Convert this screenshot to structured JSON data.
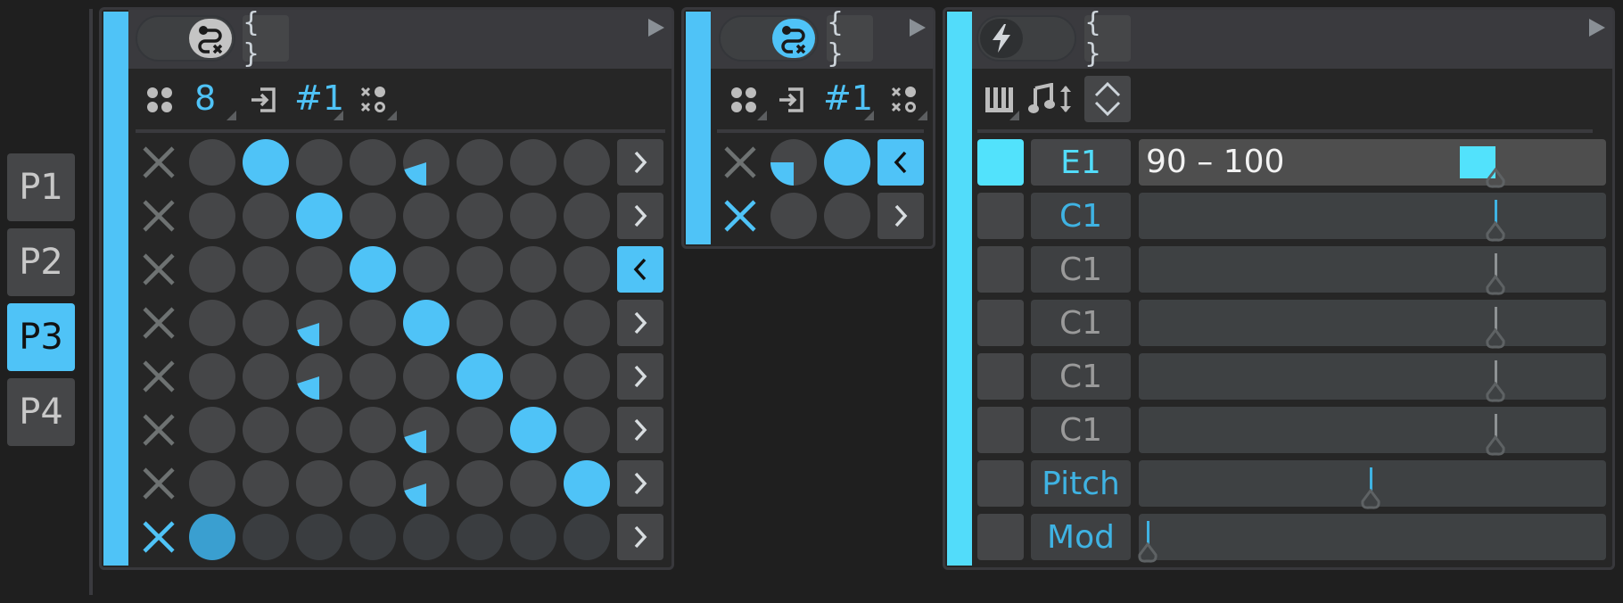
{
  "colors": {
    "accent": "#4fc3f7",
    "accent_cyan": "#52e2fc",
    "accent_dim": "#3a9fd0",
    "cell_off": "#454648",
    "cell_off_dim": "#3a3d40",
    "x_off": "#6e7272",
    "panel_bg": "#262626",
    "header_bg": "#3a3a3e"
  },
  "pages": {
    "items": [
      {
        "label": "P1",
        "active": false
      },
      {
        "label": "P2",
        "active": false
      },
      {
        "label": "P3",
        "active": true
      },
      {
        "label": "P4",
        "active": false
      }
    ]
  },
  "panel1": {
    "toggle_icon": "route-off-icon",
    "toggle_on": false,
    "braces_label": "{ }",
    "toolbar": {
      "steps_icon": "four-dots-icon",
      "steps_value": "8",
      "input_icon": "enter-icon",
      "channel_value": "#1",
      "mode_icon": "xo-pattern-icon"
    },
    "grid": {
      "columns": 8,
      "rows": [
        {
          "x_active": false,
          "cells": [
            0,
            1,
            0,
            0,
            0.2,
            0,
            0,
            0
          ],
          "button": ">",
          "button_active": false
        },
        {
          "x_active": false,
          "cells": [
            0,
            0,
            1,
            0,
            0,
            0,
            0,
            0
          ],
          "button": ">",
          "button_active": false
        },
        {
          "x_active": false,
          "cells": [
            0,
            0,
            0,
            1,
            0,
            0,
            0,
            0
          ],
          "button": "<",
          "button_active": true
        },
        {
          "x_active": false,
          "cells": [
            0,
            0,
            0.2,
            0,
            1,
            0,
            0,
            0
          ],
          "button": ">",
          "button_active": false
        },
        {
          "x_active": false,
          "cells": [
            0,
            0,
            0.2,
            0,
            0,
            1,
            0,
            0
          ],
          "button": ">",
          "button_active": false
        },
        {
          "x_active": false,
          "cells": [
            0,
            0,
            0,
            0,
            0.2,
            0,
            1,
            0
          ],
          "button": ">",
          "button_active": false
        },
        {
          "x_active": false,
          "cells": [
            0,
            0,
            0,
            0,
            0.2,
            0,
            0,
            1
          ],
          "button": ">",
          "button_active": false
        },
        {
          "x_active": true,
          "dim": true,
          "cells": [
            1,
            0,
            0,
            0,
            0,
            0,
            0,
            0
          ],
          "button": ">",
          "button_active": false
        }
      ]
    }
  },
  "panel2": {
    "toggle_icon": "route-on-icon",
    "toggle_on": true,
    "braces_label": "{ }",
    "toolbar": {
      "steps_icon": "four-dots-icon",
      "input_icon": "enter-icon",
      "channel_value": "#1",
      "mode_icon": "xo-pattern-icon"
    },
    "grid": {
      "columns": 2,
      "rows": [
        {
          "x_active": false,
          "cells": [
            0.25,
            1
          ],
          "button": "<",
          "button_active": true
        },
        {
          "x_active": true,
          "cells": [
            0,
            0
          ],
          "button": ">",
          "button_active": false
        }
      ]
    }
  },
  "panel3": {
    "toggle_icon": "lightning-icon",
    "toggle_on": false,
    "braces_label": "{ }",
    "toolbar": {
      "keys_icon": "piano-keys-icon",
      "note_transpose_icon": "note-updown-icon",
      "updown_icon": "chevron-up-down-icon"
    },
    "rows": [
      {
        "swatch_active": true,
        "label": "E1",
        "label_color": "cyan",
        "text": "90 – 100",
        "range": [
          90,
          100
        ],
        "value": 0.78,
        "marker": "range"
      },
      {
        "swatch_active": false,
        "label": "C1",
        "label_color": "blue",
        "value": 0.78,
        "marker": "blue"
      },
      {
        "swatch_active": false,
        "label": "C1",
        "label_color": "grey",
        "value": 0.78,
        "marker": "grey"
      },
      {
        "swatch_active": false,
        "label": "C1",
        "label_color": "grey",
        "value": 0.78,
        "marker": "grey"
      },
      {
        "swatch_active": false,
        "label": "C1",
        "label_color": "grey",
        "value": 0.78,
        "marker": "grey"
      },
      {
        "swatch_active": false,
        "label": "C1",
        "label_color": "grey",
        "value": 0.78,
        "marker": "grey"
      },
      {
        "swatch_active": false,
        "label": "Pitch",
        "label_color": "blue",
        "value": 0.5,
        "marker": "blue"
      },
      {
        "swatch_active": false,
        "label": "Mod",
        "label_color": "blue",
        "value": 0.0,
        "marker": "blue"
      }
    ]
  }
}
